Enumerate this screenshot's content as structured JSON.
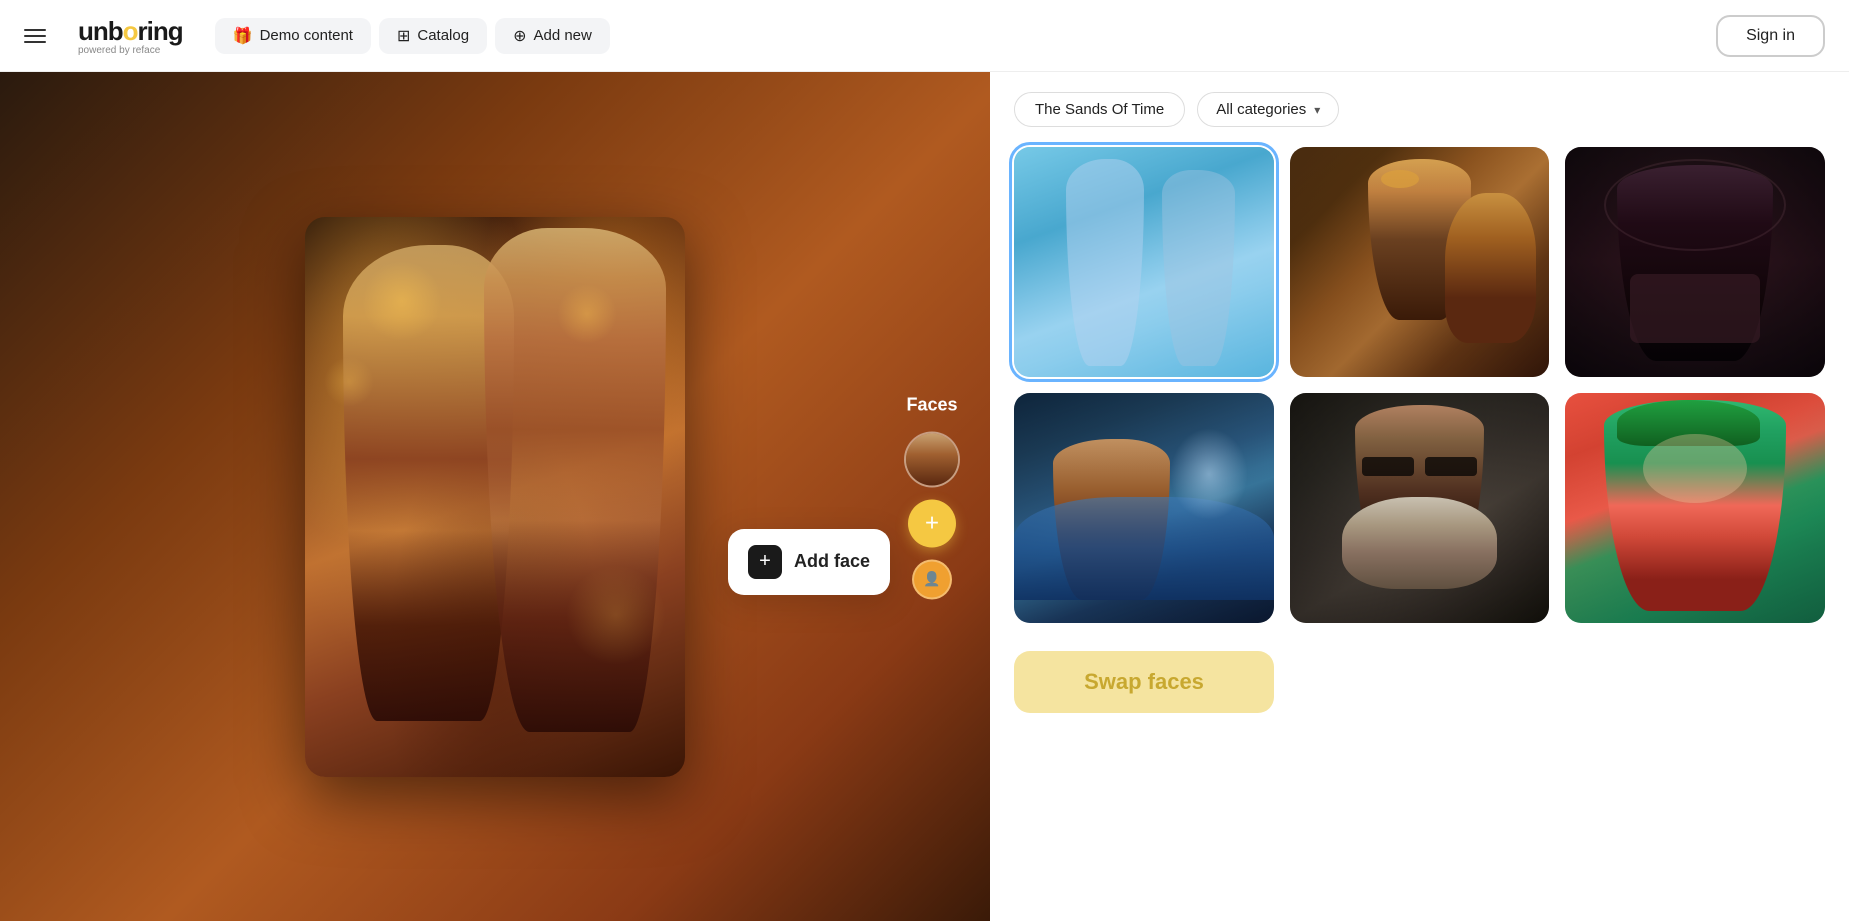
{
  "header": {
    "menu_aria": "menu",
    "logo_text": "unboring",
    "logo_sub": "powered by reface",
    "nav": [
      {
        "id": "demo-content",
        "label": "Demo content",
        "icon": "🎁"
      },
      {
        "id": "catalog",
        "label": "Catalog",
        "icon": "⊞"
      },
      {
        "id": "add-new",
        "label": "Add new",
        "icon": "⊕"
      }
    ],
    "sign_in_label": "Sign in"
  },
  "left_panel": {
    "faces_label": "Faces",
    "add_face_popup_label": "Add face"
  },
  "right_panel": {
    "filter_tag": "The Sands Of Time",
    "category_select": "All categories",
    "swap_button_label": "Swap faces"
  }
}
